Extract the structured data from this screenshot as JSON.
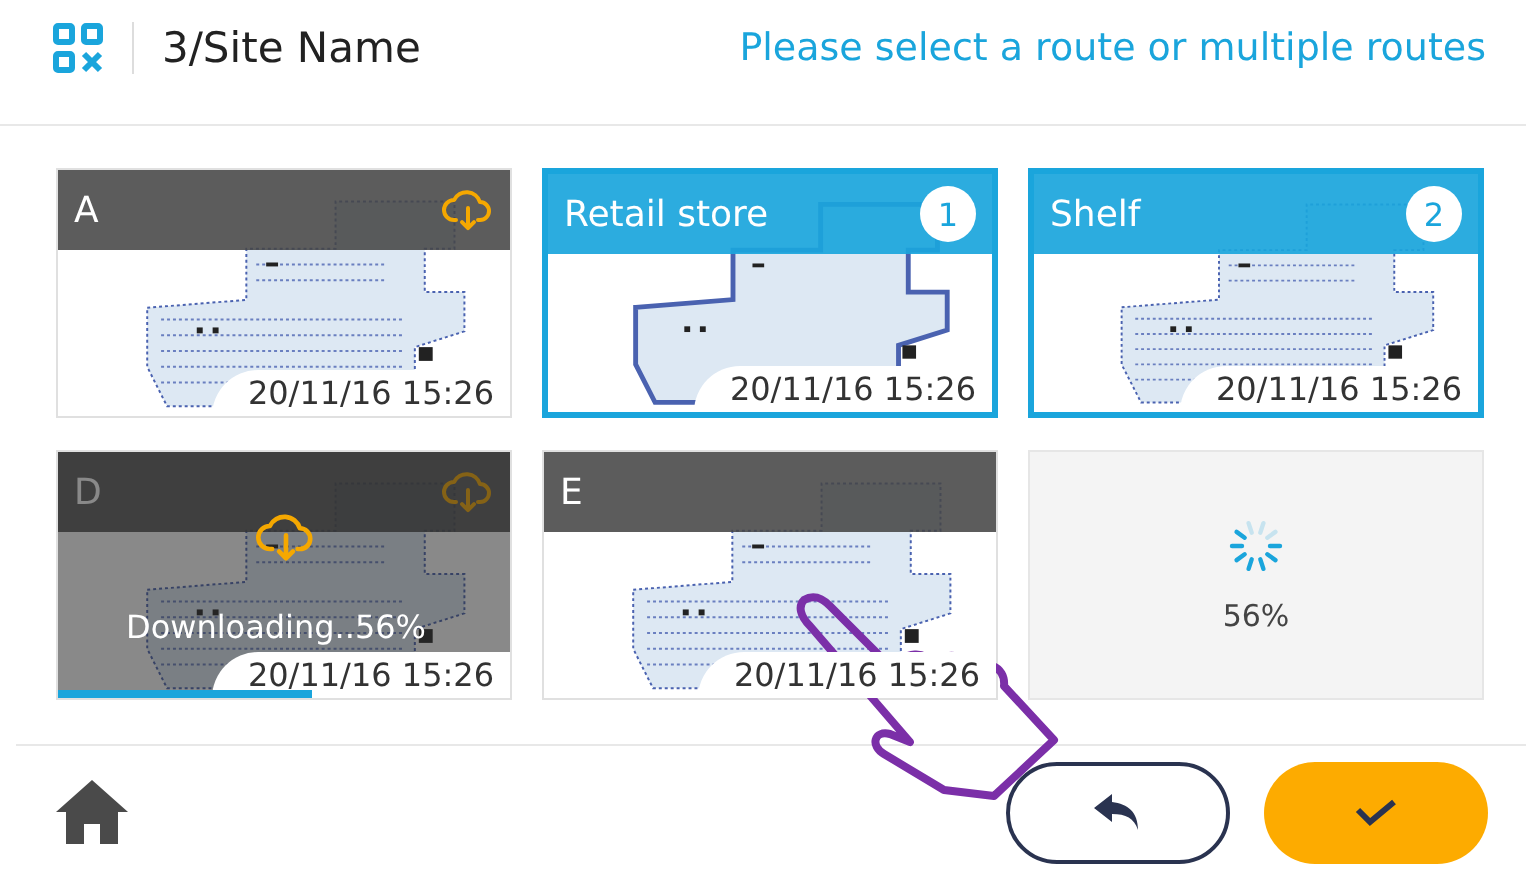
{
  "header": {
    "site": "3/Site Name",
    "prompt": "Please select a route or multiple routes"
  },
  "tiles": [
    {
      "kind": "route",
      "title": "A",
      "selected": false,
      "cloud": true,
      "time": "20/11/16 15:26"
    },
    {
      "kind": "route",
      "title": "Retail store",
      "selected": true,
      "badge": "1",
      "cloud": false,
      "time": "20/11/16 15:26"
    },
    {
      "kind": "route",
      "title": "Shelf",
      "selected": true,
      "badge": "2",
      "cloud": false,
      "time": "20/11/16 15:26"
    },
    {
      "kind": "downloading",
      "title": "D",
      "cloud": true,
      "status": "Downloading..56%",
      "level": 0.56,
      "time": "20/11/16 15:26"
    },
    {
      "kind": "route",
      "title": "E",
      "selected": false,
      "cloud": false,
      "time": "20/11/16 15:26"
    },
    {
      "kind": "loading",
      "reading": "56%"
    }
  ]
}
